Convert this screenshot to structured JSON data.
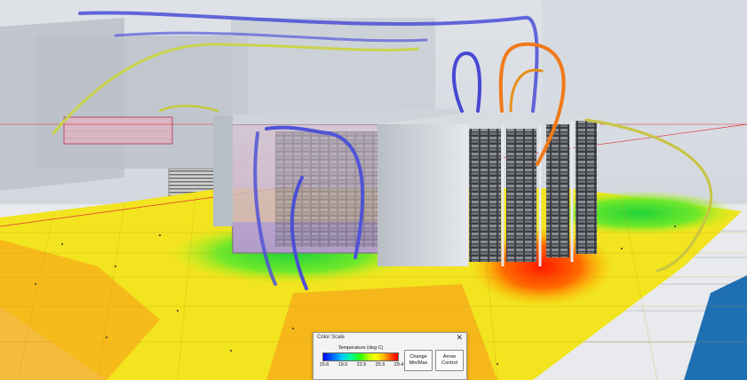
{
  "color_scale": {
    "title": "Color Scale",
    "close": "✕",
    "label": "Temperature (deg C)",
    "ticks": [
      "15.6",
      "19.0",
      "22.5",
      "25.9",
      "29.4"
    ],
    "buttons": {
      "change_minmax": "Change\nMin/Max",
      "arrow_control": "Arrow\nControl"
    },
    "colors": [
      "#0000ff",
      "#00c8ff",
      "#33ff00",
      "#ffff00",
      "#ff0000"
    ]
  },
  "scene": {
    "floor_colors": {
      "cool": "#2a5cff",
      "mid": "#52e33a",
      "warm": "#f2e41e",
      "hot": "#ff3a10"
    },
    "tiles_color": "#e9ecef",
    "water_color": "#1f6fb4",
    "streamline_colors": {
      "cool": "#4a4fd6",
      "warm": "#c9d44a",
      "hot": "#f07a1a"
    }
  }
}
